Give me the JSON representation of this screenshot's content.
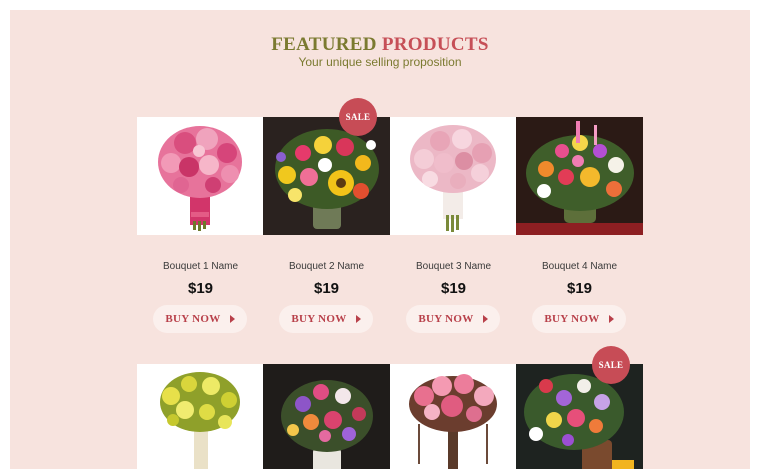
{
  "section": {
    "title_word1": "FEATURED",
    "title_word2": "PRODUCTS",
    "subtitle": "Your unique selling proposition"
  },
  "colors": {
    "page_background": "#f7e3de",
    "title_primary": "#7b7a30",
    "title_accent": "#c64f57",
    "sale_badge": "#c74c56",
    "button_background": "#fbf0ed",
    "button_text": "#b8404a"
  },
  "sale_badge_label": "SALE",
  "products": [
    {
      "name": "Bouquet 1 Name",
      "price": "$19",
      "button": "BUY NOW",
      "on_sale": false,
      "image": "pink-rose-bouquet-photo"
    },
    {
      "name": "Bouquet 2 Name",
      "price": "$19",
      "button": "BUY NOW",
      "on_sale": true,
      "image": "mixed-sunflower-vase-photo"
    },
    {
      "name": "Bouquet 3 Name",
      "price": "$19",
      "button": "BUY NOW",
      "on_sale": false,
      "image": "pale-pink-rose-bouquet-photo"
    },
    {
      "name": "Bouquet 4 Name",
      "price": "$19",
      "button": "BUY NOW",
      "on_sale": false,
      "image": "colorful-wildflower-vase-photo"
    }
  ],
  "products_row2": [
    {
      "on_sale": false,
      "image": "yellow-orchid-bouquet-photo"
    },
    {
      "on_sale": false,
      "image": "purple-mixed-vase-photo"
    },
    {
      "on_sale": false,
      "image": "pink-lily-bouquet-photo"
    },
    {
      "on_sale": true,
      "image": "wildflower-pot-photo"
    }
  ]
}
